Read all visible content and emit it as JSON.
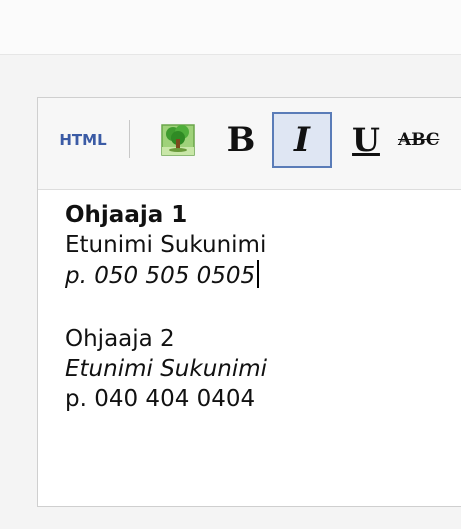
{
  "toolbar": {
    "html_label": "HTML",
    "bold_label": "B",
    "italic_label": "I",
    "underline_label": "U",
    "strike_label": "ABC",
    "image_icon": "tree-image-icon",
    "italic_active": true
  },
  "content": {
    "heading_1": "Ohjaaja 1",
    "name_1": "Etunimi Sukunimi",
    "phone_1": "p. 050 505 0505",
    "heading_2": "Ohjaaja 2",
    "name_2": "Etunimi Sukunimi",
    "phone_2": "p. 040 404 0404"
  },
  "colors": {
    "accent": "#5a7cb8",
    "active_bg": "#dfe6f3",
    "html_text": "#3b5ba5"
  }
}
